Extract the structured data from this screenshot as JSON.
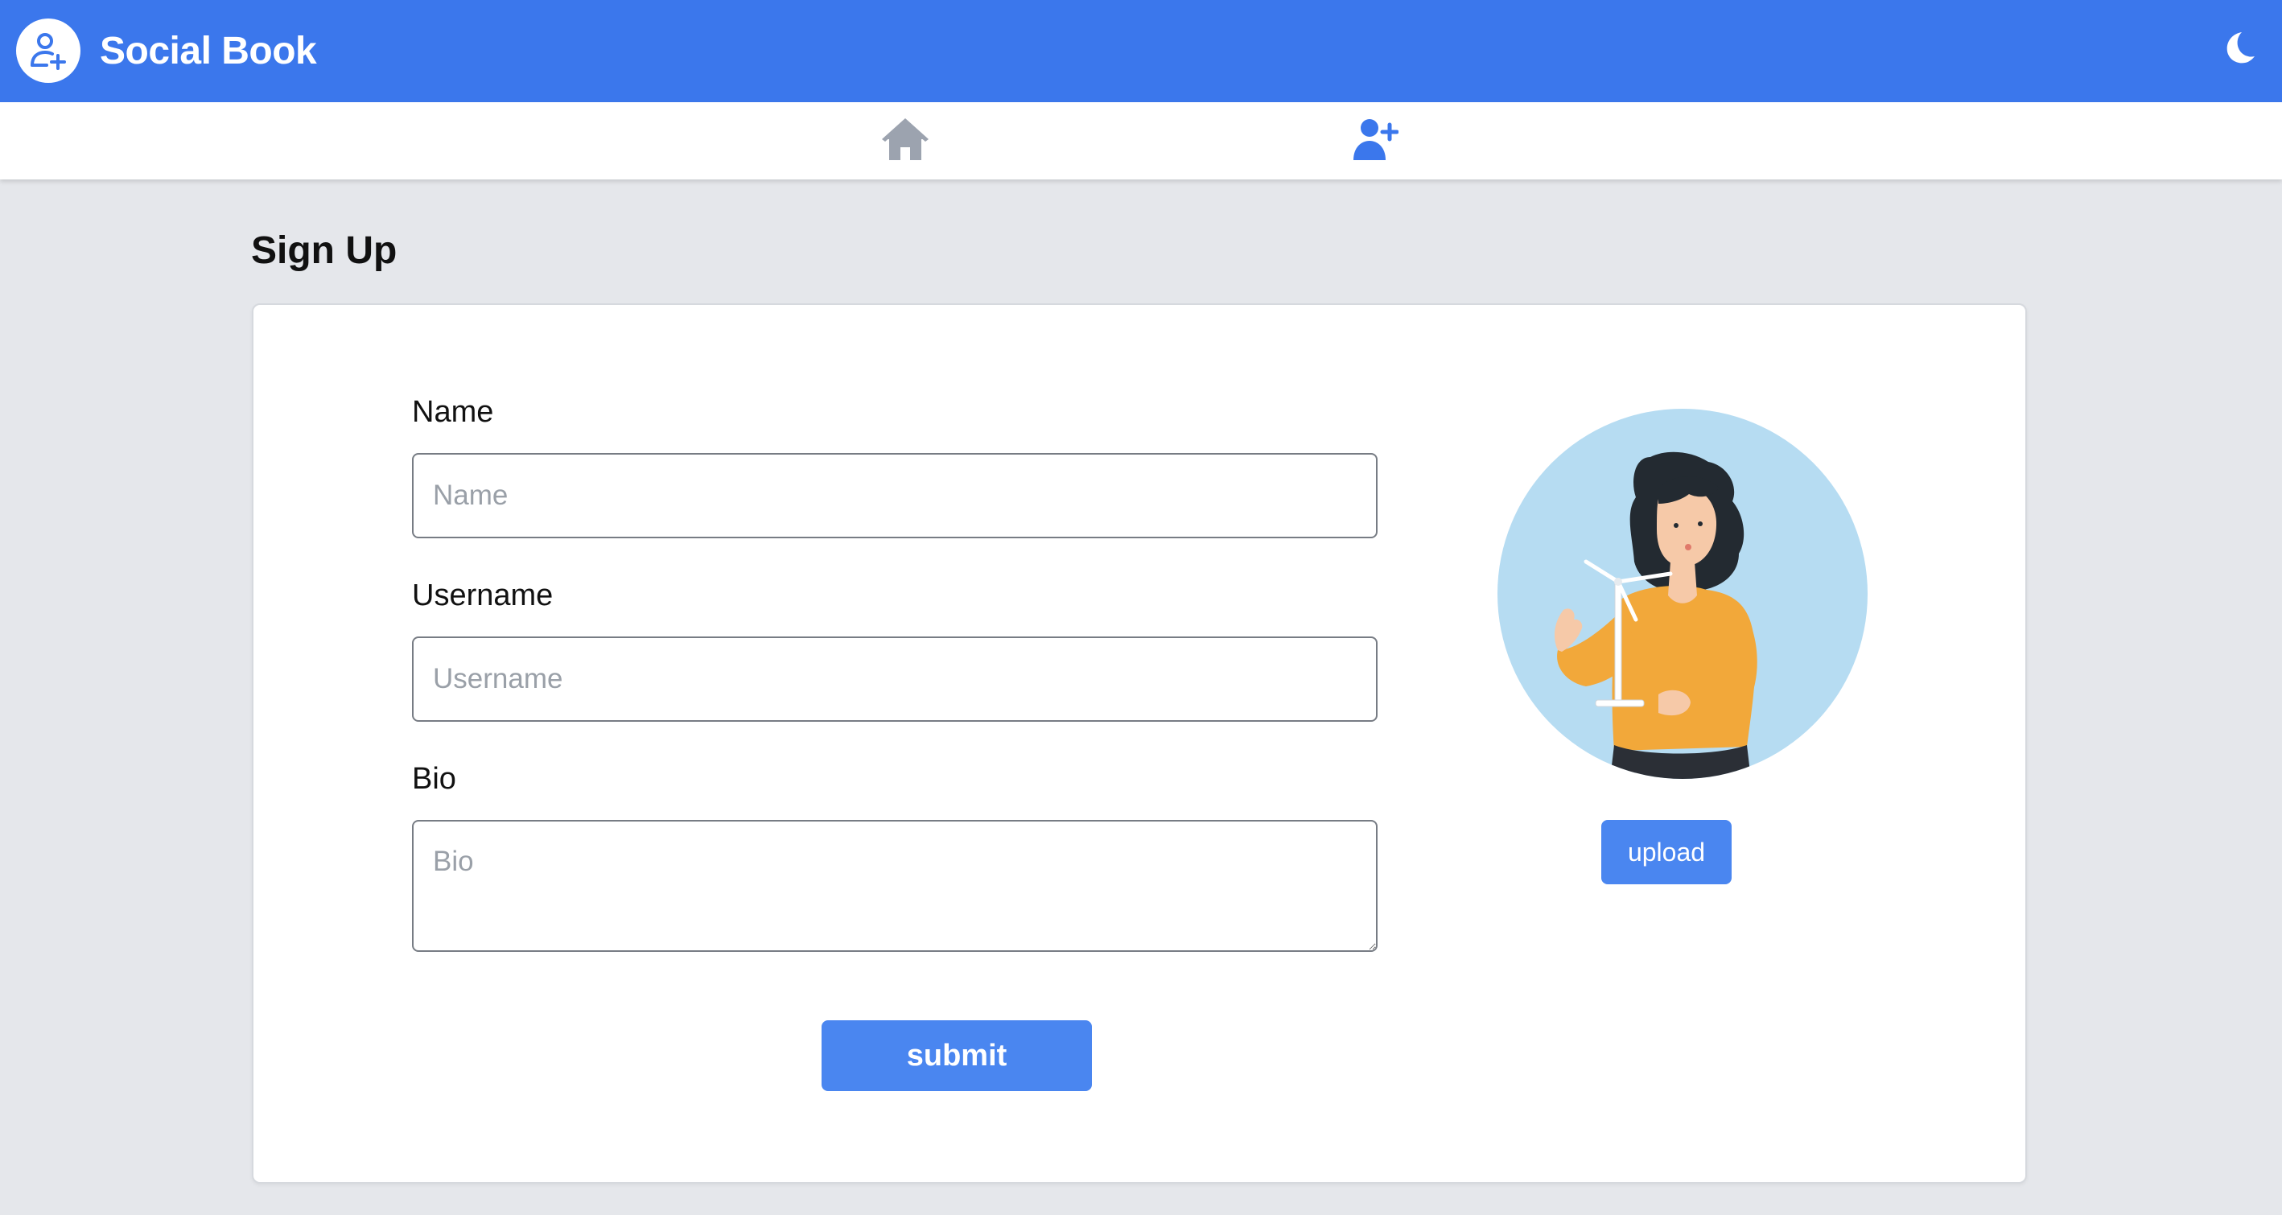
{
  "app": {
    "title": "Social Book",
    "logo_icon": "user-plus-icon",
    "theme_toggle_icon": "moon-icon"
  },
  "nav": {
    "items": [
      {
        "icon": "home-icon",
        "active": false
      },
      {
        "icon": "user-plus-icon",
        "active": true
      }
    ]
  },
  "page": {
    "title": "Sign Up"
  },
  "form": {
    "name": {
      "label": "Name",
      "placeholder": "Name",
      "value": ""
    },
    "username": {
      "label": "Username",
      "placeholder": "Username",
      "value": ""
    },
    "bio": {
      "label": "Bio",
      "placeholder": "Bio",
      "value": ""
    },
    "submit_label": "submit"
  },
  "avatar": {
    "image": "illustration-woman-holding-wind-turbine",
    "upload_label": "upload"
  },
  "colors": {
    "brand": "#3b77ec",
    "button": "#4a86f0",
    "background": "#e5e7eb",
    "nav_active": "#3b77ec",
    "nav_inactive": "#9ca3af"
  }
}
